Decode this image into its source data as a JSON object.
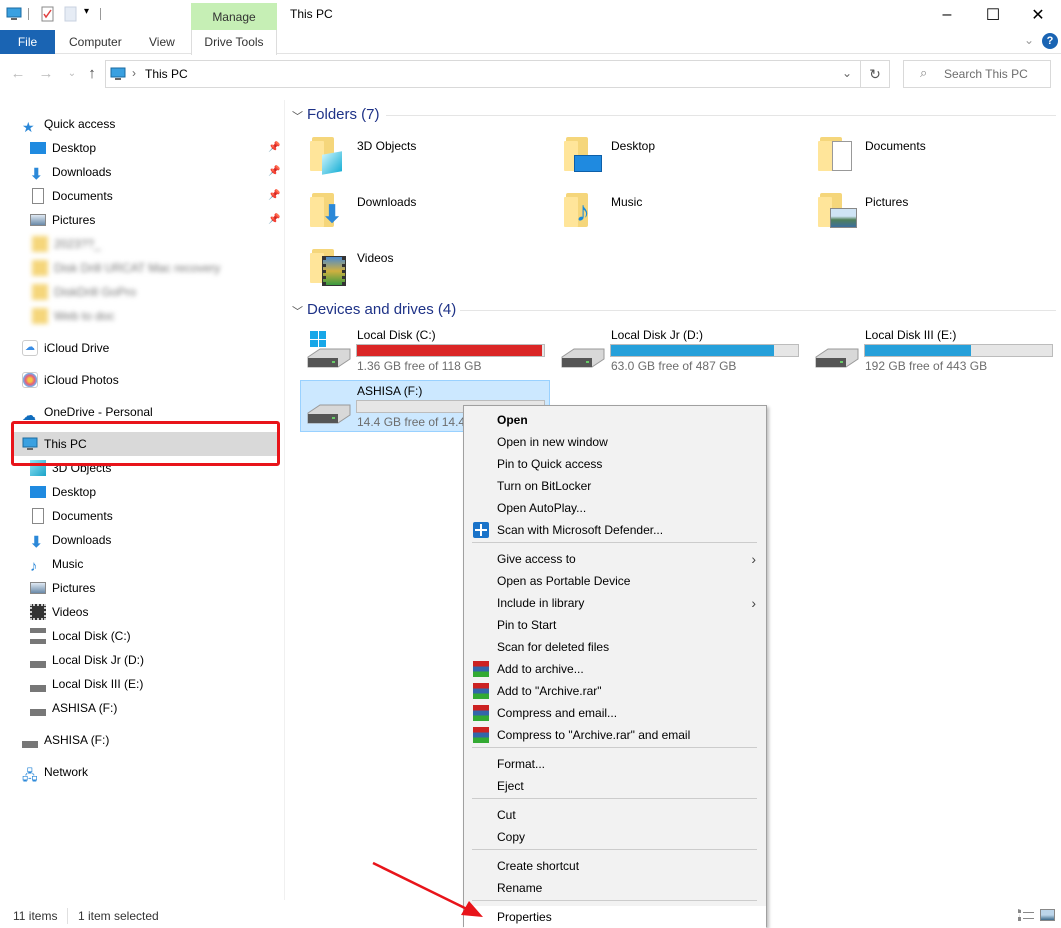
{
  "window": {
    "title": "This PC",
    "manage_label": "Manage",
    "minimize": "–",
    "maximize": "☐",
    "close": "✕"
  },
  "ribbon": {
    "tabs": [
      {
        "label": "File",
        "active": true
      },
      {
        "label": "Computer"
      },
      {
        "label": "View"
      },
      {
        "label": "Drive Tools"
      }
    ],
    "expand_icon": "⌄",
    "help_icon": "?"
  },
  "address": {
    "path": "This PC",
    "separator": "›",
    "back": "←",
    "forward": "→",
    "recent": "⌄",
    "up": "↑",
    "dropdown": "⌄",
    "refresh": "↻"
  },
  "search": {
    "placeholder": "Search This PC"
  },
  "sidebar": {
    "quick_access": {
      "label": "Quick access",
      "items": [
        {
          "label": "Desktop",
          "pinned": true
        },
        {
          "label": "Downloads",
          "pinned": true
        },
        {
          "label": "Documents",
          "pinned": true
        },
        {
          "label": "Pictures",
          "pinned": true
        }
      ],
      "blurred_items": [
        "2023??_",
        "Disk Drill URCAT Mac recovery",
        "DiskDrill GoPro",
        "Web to doc"
      ]
    },
    "icloud_drive": "iCloud Drive",
    "icloud_photos": "iCloud Photos",
    "onedrive": "OneDrive - Personal",
    "this_pc": {
      "label": "This PC",
      "items": [
        "3D Objects",
        "Desktop",
        "Documents",
        "Downloads",
        "Music",
        "Pictures",
        "Videos",
        "Local Disk (C:)",
        "Local Disk Jr (D:)",
        "Local Disk III (E:)",
        "ASHISA (F:)"
      ]
    },
    "ashisa": "ASHISA (F:)",
    "network": "Network"
  },
  "content": {
    "folders_header": "Folders (7)",
    "folders": [
      "3D Objects",
      "Desktop",
      "Documents",
      "Downloads",
      "Music",
      "Pictures",
      "Videos"
    ],
    "drives_header": "Devices and drives (4)",
    "drives": [
      {
        "name": "Local Disk (C:)",
        "free": "1.36 GB free of 118 GB",
        "used_fraction": 0.988,
        "bar_color": "#da2626"
      },
      {
        "name": "Local Disk Jr (D:)",
        "free": "63.0 GB free of 487 GB",
        "used_fraction": 0.871,
        "bar_color": "#26a0da"
      },
      {
        "name": "Local Disk III (E:)",
        "free": "192 GB free of 443 GB",
        "used_fraction": 0.567,
        "bar_color": "#26a0da"
      },
      {
        "name": "ASHISA (F:)",
        "free": "14.4 GB free of 14.4 GB",
        "used_fraction": 0.0,
        "bar_color": "#26a0da",
        "selected": true
      }
    ]
  },
  "context_menu": {
    "items": [
      {
        "label": "Open",
        "bold": true
      },
      {
        "label": "Open in new window"
      },
      {
        "label": "Pin to Quick access"
      },
      {
        "label": "Turn on BitLocker"
      },
      {
        "label": "Open AutoPlay..."
      },
      {
        "label": "Scan with Microsoft Defender...",
        "icon": "defender-icon"
      },
      {
        "label": "Give access to",
        "submenu": true
      },
      {
        "label": "Open as Portable Device"
      },
      {
        "label": "Include in library",
        "submenu": true
      },
      {
        "label": "Pin to Start"
      },
      {
        "label": "Scan for deleted files"
      },
      {
        "label": "Add to archive...",
        "icon": "winrar-icon"
      },
      {
        "label": "Add to \"Archive.rar\"",
        "icon": "winrar-icon"
      },
      {
        "label": "Compress and email...",
        "icon": "winrar-icon"
      },
      {
        "label": "Compress to \"Archive.rar\" and email",
        "icon": "winrar-icon"
      },
      {
        "label": "Format..."
      },
      {
        "label": "Eject"
      },
      {
        "label": "Cut"
      },
      {
        "label": "Copy"
      },
      {
        "label": "Create shortcut"
      },
      {
        "label": "Rename"
      },
      {
        "label": "Properties",
        "highlighted": true
      }
    ],
    "submenu_arrow": "›"
  },
  "status": {
    "items_count": "11 items",
    "selected": "1 item selected"
  },
  "annotations": {
    "highlight_color": "#e8141a"
  }
}
